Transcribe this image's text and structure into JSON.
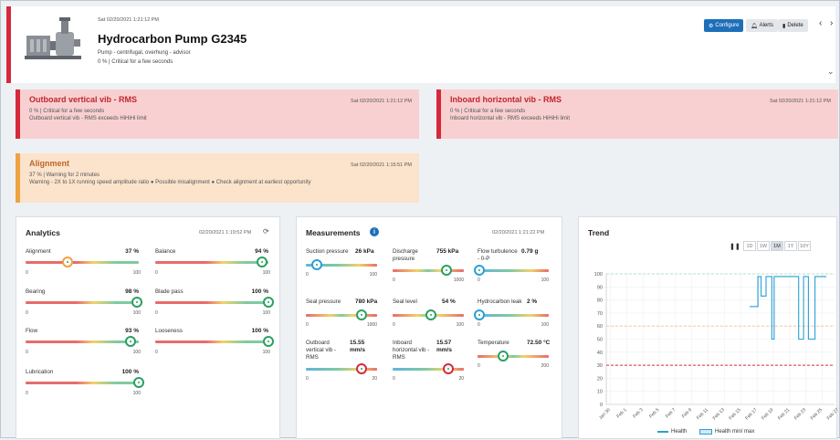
{
  "header": {
    "timestamp": "Sat 02/20/2021 1:21:12 PM",
    "title": "Hydrocarbon Pump G2345",
    "subtitle": "Pump - centrifugal, overhung - advisor",
    "status": "0 % | Critical for a few seconds",
    "configure_label": "Configure",
    "alerts_label": "Alerts",
    "delete_label": "Delete"
  },
  "alerts": [
    {
      "title": "Outboard vertical vib - RMS",
      "timestamp": "Sat 02/20/2021 1:21:12 PM",
      "line1": "0 % | Critical for a few seconds",
      "line2": "Outboard vertical vib - RMS exceeds HiHiHi limit"
    },
    {
      "title": "Inboard horizontal vib - RMS",
      "timestamp": "Sat 02/20/2021 1:21:12 PM",
      "line1": "0 % | Critical for a few seconds",
      "line2": "Inboard horizontal vib - RMS exceeds HiHiHi limit"
    },
    {
      "title": "Alignment",
      "timestamp": "Sat 02/20/2021 1:15:51 PM",
      "line1": "37 % | Warning for 2 minutes",
      "line2": "Warning - 2X to 1X running speed amplitude ratio ● Possible misalignment ● Check alignment at earliest opportunity"
    }
  ],
  "analytics": {
    "title": "Analytics",
    "timestamp": "02/20/2021 1:19:52 PM",
    "items": [
      {
        "name": "Alignment",
        "value": "37 %",
        "level": 37,
        "min": "0",
        "max": "100"
      },
      {
        "name": "Balance",
        "value": "94 %",
        "level": 94,
        "min": "0",
        "max": "100"
      },
      {
        "name": "Bearing",
        "value": "98 %",
        "level": 98,
        "min": "0",
        "max": "100"
      },
      {
        "name": "Blade pass",
        "value": "100 %",
        "level": 100,
        "min": "0",
        "max": "100"
      },
      {
        "name": "Flow",
        "value": "93 %",
        "level": 93,
        "min": "0",
        "max": "100"
      },
      {
        "name": "Looseness",
        "value": "100 %",
        "level": 100,
        "min": "0",
        "max": "100"
      },
      {
        "name": "Lubrication",
        "value": "100 %",
        "level": 100,
        "min": "0",
        "max": "100"
      }
    ]
  },
  "measurements": {
    "title": "Measurements",
    "timestamp": "02/20/2021 1:21:22 PM",
    "items": [
      {
        "name": "Suction pressure",
        "value": "26 kPa",
        "level": 15,
        "min": "0",
        "max": "100",
        "scale": "asc",
        "color": "#2a9fd6"
      },
      {
        "name": "Discharge pressure",
        "value": "755 kPa",
        "level": 75,
        "min": "0",
        "max": "1000",
        "scale": "mid",
        "color": "#2aa062"
      },
      {
        "name": "Flow turbulence - 0-P",
        "value": "0.79 g",
        "level": 2,
        "min": "0",
        "max": "100",
        "scale": "asc",
        "color": "#2a9fd6"
      },
      {
        "name": "Seal pressure",
        "value": "780 kPa",
        "level": 78,
        "min": "0",
        "max": "1000",
        "scale": "mid",
        "color": "#2aa062"
      },
      {
        "name": "Seal level",
        "value": "54 %",
        "level": 54,
        "min": "0",
        "max": "100",
        "scale": "mid",
        "color": "#2aa062"
      },
      {
        "name": "Hydrocarbon leak",
        "value": "2 %",
        "level": 2,
        "min": "0",
        "max": "100",
        "scale": "asc",
        "color": "#2a9fd6"
      },
      {
        "name": "Outboard vertical vib - RMS",
        "value": "15.55 mm/s",
        "level": 78,
        "min": "0",
        "max": "20",
        "scale": "asc",
        "color": "#d6293c"
      },
      {
        "name": "Inboard horizontal vib - RMS",
        "value": "15.57 mm/s",
        "level": 78,
        "min": "0",
        "max": "20",
        "scale": "asc",
        "color": "#d6293c"
      },
      {
        "name": "Temperature",
        "value": "72.50 °C",
        "level": 36,
        "min": "0",
        "max": "200",
        "scale": "mid",
        "color": "#2aa062"
      }
    ]
  },
  "trend": {
    "title": "Trend",
    "ranges": [
      "1D",
      "1W",
      "1M",
      "1Y",
      "10Y"
    ],
    "active_range": "1M",
    "legend_health": "Health",
    "legend_minmax": "Health min/ max"
  },
  "chart_data": {
    "type": "line",
    "title": "Trend",
    "ylim": [
      0,
      100
    ],
    "y_ticks": [
      0,
      10,
      20,
      30,
      40,
      50,
      60,
      70,
      80,
      90,
      100
    ],
    "x": [
      "Jan 30",
      "Feb 1",
      "Feb 3",
      "Feb 5",
      "Feb 7",
      "Feb 9",
      "Feb 11",
      "Feb 13",
      "Feb 15",
      "Feb 17",
      "Feb 19",
      "Feb 21",
      "Feb 23",
      "Feb 25",
      "Feb 27"
    ],
    "thresholds": [
      {
        "value": 30,
        "color": "#d6293c"
      },
      {
        "value": 60,
        "color": "#f5c08a"
      },
      {
        "value": 100,
        "color": "#a8d8c0"
      }
    ],
    "series": [
      {
        "name": "Health",
        "points": [
          [
            17.6,
            75
          ],
          [
            18.6,
            75
          ],
          [
            18.6,
            98
          ],
          [
            19.0,
            98
          ],
          [
            19.0,
            83
          ],
          [
            19.6,
            83
          ],
          [
            19.6,
            98
          ],
          [
            20.3,
            98
          ],
          [
            20.3,
            50
          ],
          [
            20.6,
            50
          ],
          [
            20.6,
            98
          ],
          [
            23.6,
            98
          ],
          [
            23.6,
            50
          ],
          [
            24.2,
            50
          ],
          [
            24.2,
            98
          ],
          [
            24.8,
            98
          ],
          [
            24.8,
            50
          ],
          [
            25.6,
            50
          ],
          [
            25.6,
            98
          ],
          [
            27.0,
            98
          ]
        ]
      }
    ]
  }
}
